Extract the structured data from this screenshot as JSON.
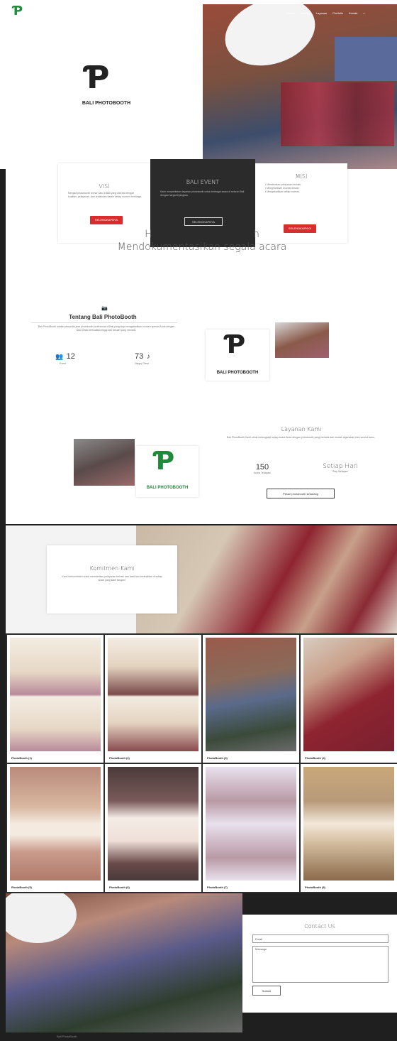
{
  "nav": {
    "items": [
      "Home",
      "Tentang",
      "Layanan",
      "Portfolio",
      "Kontak"
    ]
  },
  "hero": {
    "brand": "BALI PHOTOBOOTH",
    "headline_line1": "H                                h",
    "headline_line2": "Mendokumentasikan segala acara"
  },
  "cards": [
    {
      "title": "VISI",
      "text": "Menjadi photobooth nomor satu di Bali yang dikenal dengan kualitas, pelayanan, dan kreativitas dalam setiap momen berharga.",
      "button": "SELENGKAPNYA"
    },
    {
      "title": "BALI EVENT",
      "text": "Kami menyediakan layanan photobooth untuk berbagai acara di seluruh Bali dengan harga terjangkau.",
      "button": "SELENGKAPNYA"
    },
    {
      "title": "MISI",
      "text": "• Memberikan pelayanan terbaik.\n• Menghadirkan inovasi desain.\n• Mengabadikan setiap momen.",
      "button": "SELENGKAPNYA"
    }
  ],
  "about": {
    "title": "Tentang Bali PhotoBooth",
    "text": "Bali PhotoBooth adalah penyedia jasa photobooth profesional di Bali yang siap mengabadikan momen spesial Anda dengan hasil cetak berkualitas tinggi dan desain yang menarik.",
    "stat1_value": "12",
    "stat1_label": "Event",
    "stat2_value": "73",
    "stat2_label": "Happy Client"
  },
  "layanan": {
    "title": "Layanan Kami",
    "text": "Bali PhotoBooth hadir untuk melengkapi setiap acara Anda dengan photobooth yang menarik dan mudah digunakan oleh semua tamu.",
    "stat1_value": "150",
    "stat1_label": "Acara Terlayani",
    "stat2_value": "Setiap Hari",
    "stat2_label": "Siap Melayani",
    "button": "Pesan photobooth sekarang"
  },
  "komitmen": {
    "title": "Komitmen Kami",
    "text": "Kami berkomitmen untuk memberikan pelayanan terbaik dan hasil foto berkualitas di setiap acara yang kami tangani."
  },
  "gallery": [
    "PhotoBooth (1)",
    "PhotoBooth (2)",
    "PhotoBooth (3)",
    "PhotoBooth (4)",
    "PhotoBooth (5)",
    "PhotoBooth (6)",
    "PhotoBooth (7)",
    "PhotoBooth (8)"
  ],
  "contact": {
    "title": "Contact Us",
    "email_placeholder": "Email",
    "message_placeholder": "Message",
    "submit": "Submit"
  },
  "footer": {
    "text": "Bali PhotoBooth"
  },
  "colors": {
    "accent_red": "#d92c2c",
    "brand_green": "#1f8a3a",
    "dark": "#1f1f1f"
  }
}
